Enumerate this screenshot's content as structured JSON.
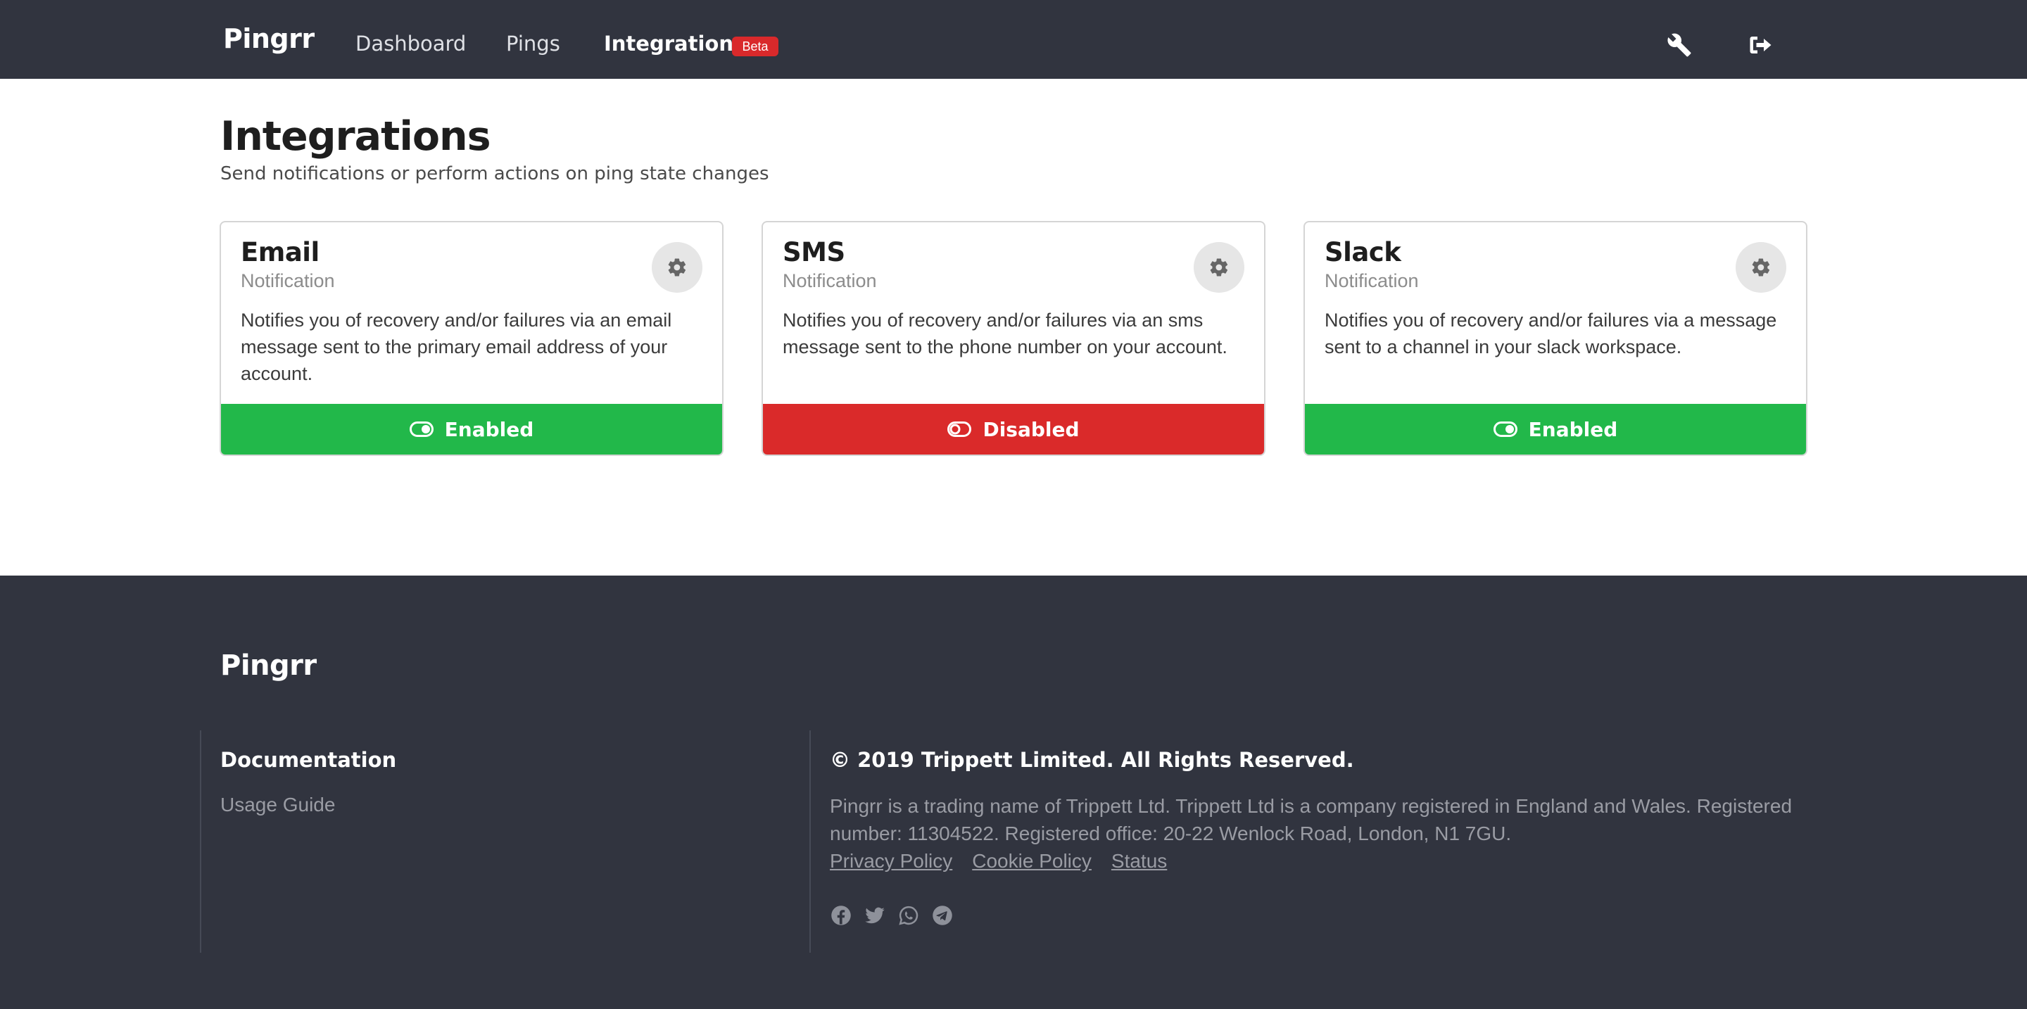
{
  "nav": {
    "brand": "Pingrr",
    "links": [
      {
        "label": "Dashboard"
      },
      {
        "label": "Pings"
      },
      {
        "label": "Integrations"
      }
    ],
    "beta_badge": "Beta",
    "icons": [
      "wrench-icon",
      "sign-out-icon"
    ]
  },
  "header": {
    "title": "Integrations",
    "subtitle": "Send notifications or perform actions on ping state changes"
  },
  "integrations": [
    {
      "title": "Email",
      "type": "Notification",
      "description": "Notifies you of recovery and/or failures via an email message sent to the primary email address of your account.",
      "status": "Enabled"
    },
    {
      "title": "SMS",
      "type": "Notification",
      "description": "Notifies you of recovery and/or failures via an sms message sent to the phone number on your account.",
      "status": "Disabled"
    },
    {
      "title": "Slack",
      "type": "Notification",
      "description": "Notifies you of recovery and/or failures via a message sent to a channel in your slack workspace.",
      "status": "Enabled"
    }
  ],
  "colors": {
    "nav_bg": "#31343f",
    "enabled": "#22b84a",
    "disabled": "#da2a2a",
    "beta": "#d9292b"
  },
  "footer": {
    "brand": "Pingrr",
    "docs_heading": "Documentation",
    "docs_link": "Usage Guide",
    "copyright": "© 2019 Trippett Limited. All Rights Reserved.",
    "about": "Pingrr is a trading name of Trippett Ltd. Trippett Ltd is a company registered in England and Wales. Registered number: 11304522. Registered office: 20-22 Wenlock Road, London, N1 7GU.",
    "links": [
      "Privacy Policy",
      "Cookie Policy",
      "Status"
    ],
    "social_icons": [
      "facebook-icon",
      "twitter-icon",
      "whatsapp-icon",
      "telegram-icon"
    ]
  }
}
